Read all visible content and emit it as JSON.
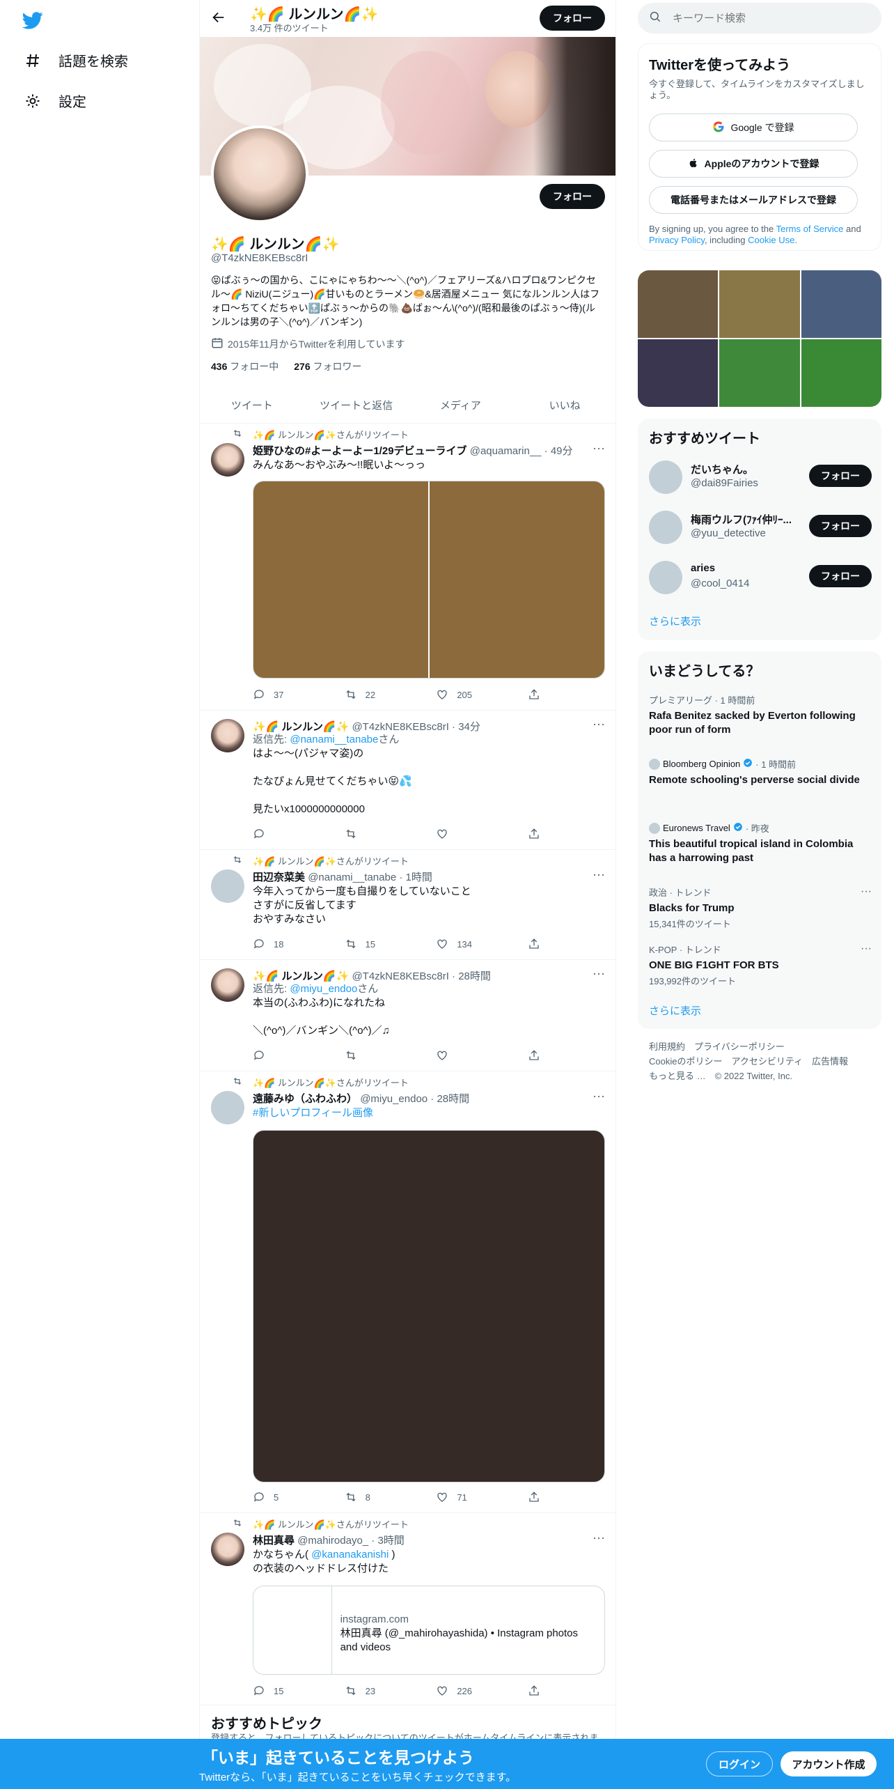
{
  "nav": {
    "explore_label": "話題を検索",
    "settings_label": "設定"
  },
  "header": {
    "name": "✨🌈 ルンルン🌈✨",
    "tweet_count": "3.4万 件のツイート",
    "follow_label": "フォロー"
  },
  "profile": {
    "name": "✨🌈 ルンルン🌈✨",
    "handle": "@T4zkNE8KEBsc8rI",
    "bio": "😝ぱぶぅ〜の国から、こにゃにゃちわ〜〜＼(^o^)／フェアリーズ&ハロプロ&ワンピクセル〜🌈 NiziU(ニジュー)🌈甘いものとラーメン🥯&居酒屋メニュー 気になルンルン人はフォロ〜ちてくだちゃい🔝ぱぶぅ〜からの🐘💩ばぉ〜ん\\(^o^)/(昭和最後のぱぶぅ〜侍)(ルンルンは男の子＼(^o^)／バンギン)",
    "joined": "2015年11月からTwitterを利用しています",
    "following_count": "436",
    "following_label": "フォロー中",
    "followers_count": "276",
    "followers_label": "フォロワー",
    "follow_label": "フォロー"
  },
  "tabs": [
    "ツイート",
    "ツイートと返信",
    "メディア",
    "いいね"
  ],
  "tweets": [
    {
      "retweet_label": "✨🌈 ルンルン🌈✨さんがリツイート",
      "name": "姫野ひなの#よーよーよー1/29デビューライブ",
      "meta": "@aquamarin__ · 49分",
      "text": "みんなあ〜おやぶみ〜!!眠いよ〜っっ",
      "reply": "37",
      "retweet": "22",
      "like": "205"
    },
    {
      "name": "✨🌈 ルンルン🌈✨",
      "meta": "@T4zkNE8KEBsc8rI · 34分",
      "reply_to_prefix": "返信先: ",
      "reply_to_handle": "@nanami__tanabe",
      "reply_to_suffix": "さん",
      "text": "はよ〜〜(パジャマ姿)の\n\nたなぴょん見せてくだちゃい😝💦\n\n見たいx1000000000000",
      "reply": "",
      "retweet": "",
      "like": ""
    },
    {
      "retweet_label": "✨🌈 ルンルン🌈✨さんがリツイート",
      "name": "田辺奈菜美",
      "meta": "@nanami__tanabe · 1時間",
      "text": "今年入ってから一度も自撮りをしていないこと\nさすがに反省してます\nおやすみなさい",
      "reply": "18",
      "retweet": "15",
      "like": "134"
    },
    {
      "name": "✨🌈 ルンルン🌈✨",
      "meta": "@T4zkNE8KEBsc8rI · 28時間",
      "reply_to_prefix": "返信先: ",
      "reply_to_handle": "@miyu_endoo",
      "reply_to_suffix": "さん",
      "text": "本当の(ふわふわ)になれたね\n\n＼(^o^)／バンギン＼(^o^)／♫",
      "reply": "",
      "retweet": "",
      "like": ""
    },
    {
      "retweet_label": "✨🌈 ルンルン🌈✨さんがリツイート",
      "name": "遠藤みゆ（ふわふわ）",
      "meta": "@miyu_endoo · 28時間",
      "hashtag": "#新しいプロフィール画像",
      "reply": "5",
      "retweet": "8",
      "like": "71"
    },
    {
      "retweet_label": "✨🌈 ルンルン🌈✨さんがリツイート",
      "name": "林田真尋",
      "meta": "@mahirodayo_ · 3時間",
      "text_prefix": "かなちゃん( ",
      "mention": "@kananakanishi",
      "text_suffix": " )",
      "text2": "の衣装のヘッドドレス付けた",
      "card_domain": "instagram.com",
      "card_title": "林田真尋 (@_mahirohayashida) • Instagram photos and videos",
      "reply": "15",
      "retweet": "23",
      "like": "226"
    }
  ],
  "recommended_topics": {
    "title": "おすすめトピック",
    "subtitle": "登録すると、フォローしているトピックについてのツイートがホームタイムラインに表示されます。"
  },
  "search": {
    "placeholder": "キーワード検索"
  },
  "signup_card": {
    "title": "Twitterを使ってみよう",
    "desc": "今すぐ登録して、タイムラインをカスタマイズしましょう。",
    "google": "Google で登録",
    "apple": "Appleのアカウントで登録",
    "phone": "電話番号またはメールアドレスで登録",
    "terms_1": "By signing up, you agree to the ",
    "terms_tos": "Terms of Service",
    "terms_2": " and ",
    "terms_privacy": "Privacy Policy",
    "terms_3": ", including ",
    "terms_cookie": "Cookie Use",
    "terms_4": "."
  },
  "photo_grid_colors": [
    "#6b5840",
    "#8a7748",
    "#4a5f80",
    "#3a3650",
    "#3f8a3a",
    "#3a8a35"
  ],
  "recommended_users": {
    "title": "おすすめツイート",
    "users": [
      {
        "name": "だいちゃん。",
        "handle": "@dai89Fairies"
      },
      {
        "name": "梅雨ウルフ(ﾌｧｲ仲ﾘｰ...",
        "handle": "@yuu_detective"
      },
      {
        "name": "aries",
        "handle": "@cool_0414"
      }
    ],
    "follow_label": "フォロー",
    "more": "さらに表示"
  },
  "trends": {
    "title": "いまどうしてる？",
    "items": [
      {
        "meta": "プレミアリーグ · 1 時間前",
        "title": "Rafa Benitez sacked by Everton following poor run of form",
        "count": ""
      },
      {
        "meta_source": "Bloomberg Opinion",
        "meta_time": " · 1 時間前",
        "title": "Remote schooling's perverse social divide",
        "count": ""
      },
      {
        "meta_source": "Euronews Travel",
        "meta_time": " · 昨夜",
        "title": "This beautiful tropical island in Colombia has a harrowing past",
        "count": ""
      },
      {
        "meta": "政治 · トレンド",
        "title": "Blacks for Trump",
        "count": "15,341件のツイート"
      },
      {
        "meta": "K-POP · トレンド",
        "title": "ONE BIG F1GHT FOR BTS",
        "count": "193,992件のツイート"
      }
    ],
    "more": "さらに表示"
  },
  "footer": {
    "line1": "利用規約　プライバシーポリシー",
    "line2": "Cookieのポリシー　アクセシビリティ　広告情報",
    "line3": "もっと見る …　© 2022 Twitter, Inc."
  },
  "bottom_bar": {
    "title": "「いま」起きていることを見つけよう",
    "subtitle": "Twitterなら、「いま」起きていることをいち早くチェックできます。",
    "login": "ログイン",
    "signup": "アカウント作成"
  },
  "colors": {
    "accent": "#1d9bf0",
    "dark_button": "#0f1419",
    "muted": "#536471"
  }
}
